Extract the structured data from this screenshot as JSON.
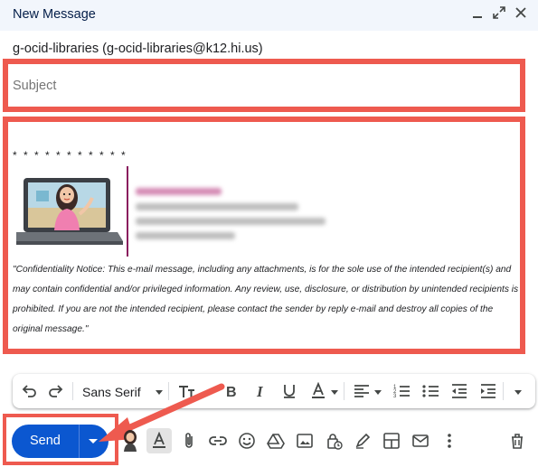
{
  "window": {
    "title": "New Message"
  },
  "compose": {
    "to": "g-ocid-libraries (g-ocid-libraries@k12.hi.us)",
    "subject_placeholder": "Subject",
    "body": {
      "separator": "* * * * * * * * * * *",
      "confidentiality_notice": "\"Confidentiality Notice:  This e-mail message, including any attachments, is for the sole use of the intended recipient(s) and may contain confidential and/or privileged information.  Any review, use, disclosure, or distribution by unintended recipients is prohibited.  If you are not the intended recipient, please contact the sender by reply e-mail and destroy all copies of the original message.\""
    }
  },
  "toolbar": {
    "font": "Sans Serif"
  },
  "actions": {
    "send_label": "Send"
  },
  "colors": {
    "highlight": "#ee5a4f",
    "send_button": "#0b57d0",
    "header_bg": "#f2f6fc",
    "signature_bar": "#8a1d5e"
  }
}
